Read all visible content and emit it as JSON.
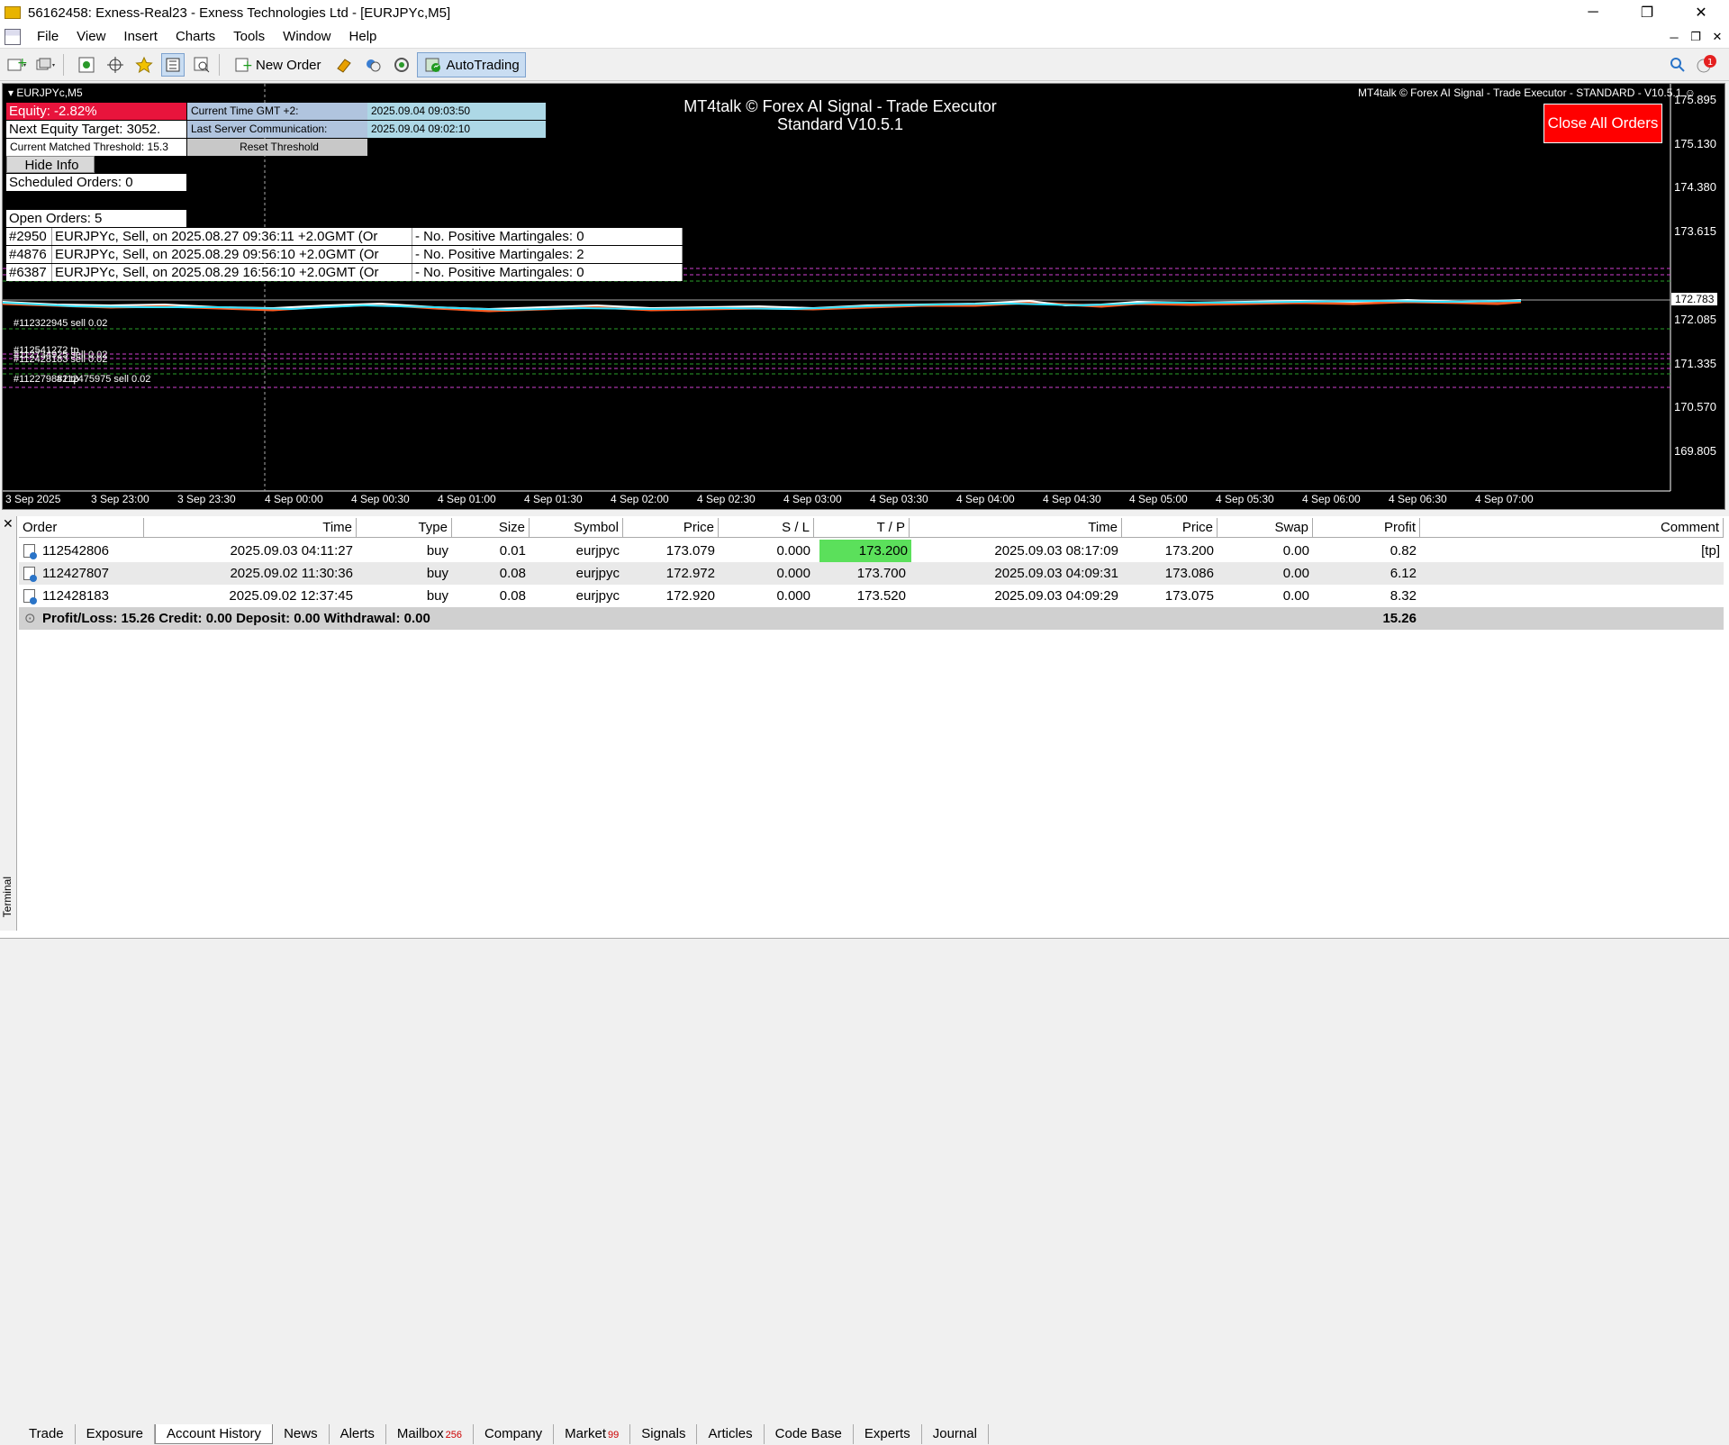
{
  "window": {
    "title": "56162458: Exness-Real23 - Exness Technologies Ltd - [EURJPYc,M5]",
    "minimize": "─",
    "restore": "❐",
    "close": "✕"
  },
  "menu": [
    "File",
    "View",
    "Insert",
    "Charts",
    "Tools",
    "Window",
    "Help"
  ],
  "toolbar": {
    "new_order": "New Order",
    "autotrading": "AutoTrading"
  },
  "chart": {
    "symbol_label": "EURJPYc,M5",
    "ea_banner": "MT4talk © Forex AI Signal - Trade Executor - STANDARD - V10.5.1 ☺",
    "ea_title_line1": "MT4talk © Forex AI Signal - Trade Executor",
    "ea_title_line2": "Standard V10.5.1",
    "close_all_button": "Close All Orders",
    "current_price": "172.783",
    "price_ticks": [
      "175.895",
      "175.130",
      "174.380",
      "173.615",
      "172.085",
      "171.335",
      "170.570",
      "169.805"
    ],
    "time_ticks": [
      "3 Sep 2025",
      "3 Sep 23:00",
      "3 Sep 23:30",
      "4 Sep 00:00",
      "4 Sep 00:30",
      "4 Sep 01:00",
      "4 Sep 01:30",
      "4 Sep 02:00",
      "4 Sep 02:30",
      "4 Sep 03:00",
      "4 Sep 03:30",
      "4 Sep 04:00",
      "4 Sep 04:30",
      "4 Sep 05:00",
      "4 Sep 05:30",
      "4 Sep 06:00",
      "4 Sep 06:30",
      "4 Sep 07:00"
    ],
    "order_labels": {
      "sell_top": "#112322945 sell 0.02",
      "stack_1": "#112541272 tp",
      "stack_2": "#112734925 sell 0.02",
      "stack_3": "#112428183 sell 0.02",
      "stack_4": "#112279882 tp",
      "stack_5": "#112475975 sell 0.02"
    }
  },
  "info_panel": {
    "equity": "Equity: -2.82%",
    "next_equity_target": "Next Equity Target: 3052.",
    "threshold": "Current Matched Threshold: 15.3",
    "current_time_label": "Current Time GMT +2:",
    "current_time_value": "2025.09.04 09:03:50",
    "last_server_label": "Last Server Communication:",
    "last_server_value": "2025.09.04 09:02:10",
    "reset_threshold": "Reset Threshold",
    "hide_info": "Hide Info",
    "scheduled_orders": "Scheduled Orders: 0",
    "open_orders": "Open Orders: 5",
    "orders": [
      {
        "id": "#2950",
        "desc": "EURJPYc, Sell, on 2025.08.27 09:36:11 +2.0GMT  (Or",
        "mart": "- No. Positive Martingales: 0"
      },
      {
        "id": "#4876",
        "desc": "EURJPYc, Sell, on 2025.08.29 09:56:10 +2.0GMT  (Or",
        "mart": "- No. Positive Martingales: 2"
      },
      {
        "id": "#6387",
        "desc": "EURJPYc, Sell, on 2025.08.29 16:56:10 +2.0GMT  (Or",
        "mart": "- No. Positive Martingales: 0"
      }
    ]
  },
  "terminal": {
    "side_label": "Terminal",
    "close": "✕",
    "columns": [
      "Order",
      "Time",
      "Type",
      "Size",
      "Symbol",
      "Price",
      "S / L",
      "T / P",
      "Time",
      "Price",
      "Swap",
      "Profit",
      "Comment"
    ],
    "rows": [
      {
        "order": "112542806",
        "open_time": "2025.09.03 04:11:27",
        "type": "buy",
        "size": "0.01",
        "symbol": "eurjpyc",
        "price": "173.079",
        "sl": "0.000",
        "tp": "173.200",
        "close_time": "2025.09.03 08:17:09",
        "close_price": "173.200",
        "swap": "0.00",
        "profit": "0.82",
        "comment": "[tp]"
      },
      {
        "order": "112427807",
        "open_time": "2025.09.02 11:30:36",
        "type": "buy",
        "size": "0.08",
        "symbol": "eurjpyc",
        "price": "172.972",
        "sl": "0.000",
        "tp": "173.700",
        "close_time": "2025.09.03 04:09:31",
        "close_price": "173.086",
        "swap": "0.00",
        "profit": "6.12",
        "comment": ""
      },
      {
        "order": "112428183",
        "open_time": "2025.09.02 12:37:45",
        "type": "buy",
        "size": "0.08",
        "symbol": "eurjpyc",
        "price": "172.920",
        "sl": "0.000",
        "tp": "173.520",
        "close_time": "2025.09.03 04:09:29",
        "close_price": "173.075",
        "swap": "0.00",
        "profit": "8.32",
        "comment": ""
      }
    ],
    "summary": "Profit/Loss: 15.26  Credit: 0.00  Deposit: 0.00  Withdrawal: 0.00",
    "summary_profit": "15.26",
    "tabs": [
      {
        "label": "Trade",
        "badge": ""
      },
      {
        "label": "Exposure",
        "badge": ""
      },
      {
        "label": "Account History",
        "badge": ""
      },
      {
        "label": "News",
        "badge": ""
      },
      {
        "label": "Alerts",
        "badge": ""
      },
      {
        "label": "Mailbox",
        "badge": "256"
      },
      {
        "label": "Company",
        "badge": ""
      },
      {
        "label": "Market",
        "badge": "99"
      },
      {
        "label": "Signals",
        "badge": ""
      },
      {
        "label": "Articles",
        "badge": ""
      },
      {
        "label": "Code Base",
        "badge": ""
      },
      {
        "label": "Experts",
        "badge": ""
      },
      {
        "label": "Journal",
        "badge": ""
      }
    ],
    "active_tab": "Account History"
  },
  "colors": {
    "equity_bg": "#e8143c",
    "tp_highlight": "#5be05b",
    "close_all_bg": "#ff0000"
  }
}
